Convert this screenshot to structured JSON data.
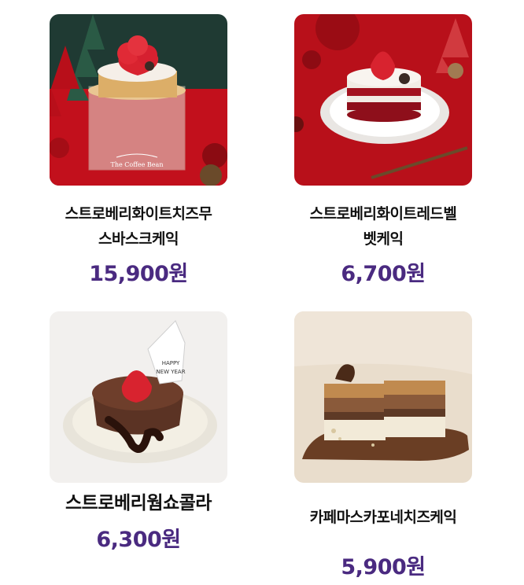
{
  "products": [
    {
      "name_line1": "스트로베리화이트치즈무",
      "name_line2": "스바스크케익",
      "price": "15,900원",
      "box_brand": "The Coffee Bean",
      "bg_color": "#c2101c"
    },
    {
      "name_line1": "스트로베리화이트레드벨",
      "name_line2": "벳케익",
      "price": "6,700원",
      "bg_color": "#b8101a"
    },
    {
      "name": "스트로베리웜쇼콜라",
      "price": "6,300원",
      "topper_text_1": "HAPPY",
      "topper_text_2": "NEW YEAR",
      "bg_color": "#f2f0ee"
    },
    {
      "name": "카페마스카포네치즈케익",
      "price": "5,900원",
      "bg_color": "#e9ddcc"
    }
  ],
  "colors": {
    "price": "#4a2a80",
    "name": "#111111"
  }
}
